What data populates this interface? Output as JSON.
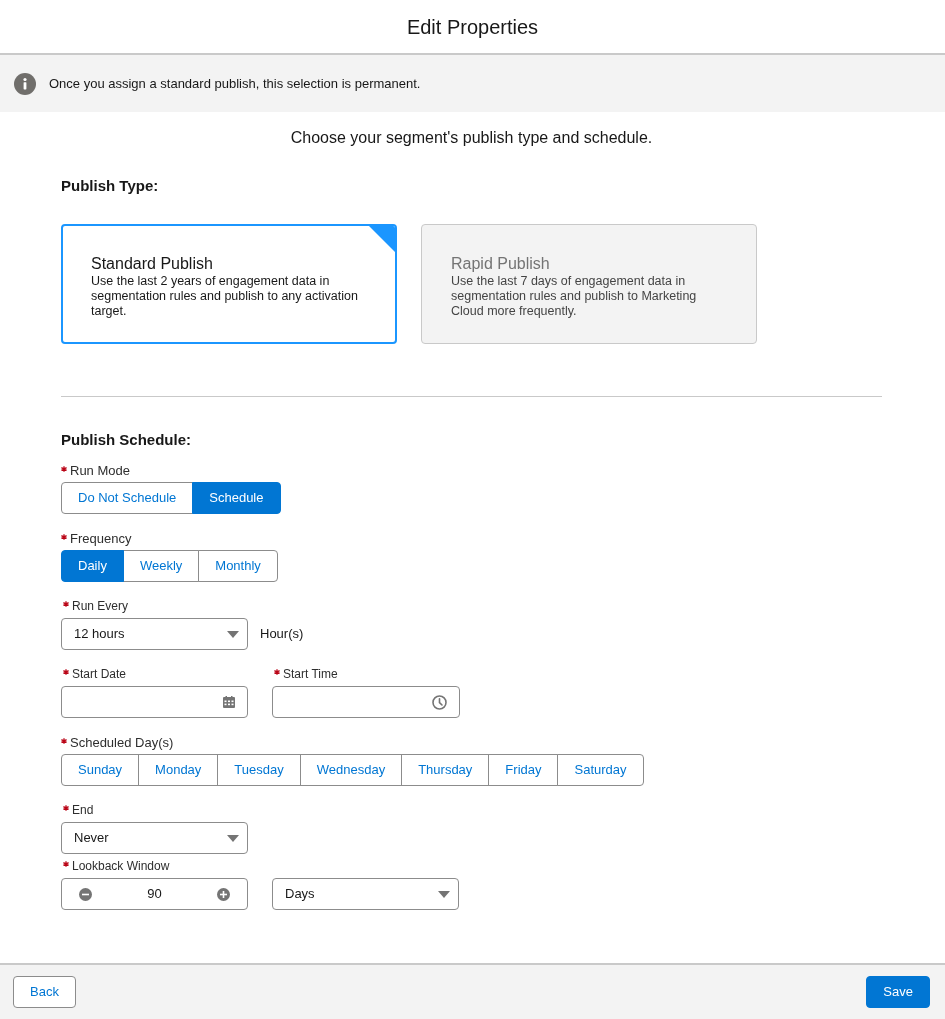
{
  "header": {
    "title": "Edit Properties"
  },
  "notice": {
    "text": "Once you assign a standard publish, this selection is permanent."
  },
  "intro": "Choose your segment's publish type and schedule.",
  "publish_type": {
    "heading": "Publish Type:",
    "options": [
      {
        "title": "Standard Publish",
        "description": "Use the last 2 years of engagement data in segmentation rules and publish to any activation target.",
        "selected": true,
        "disabled": false
      },
      {
        "title": "Rapid Publish",
        "description": "Use the last 7 days of engagement data in segmentation rules and publish to Marketing Cloud more frequently.",
        "selected": false,
        "disabled": true
      }
    ]
  },
  "publish_schedule": {
    "heading": "Publish Schedule:",
    "rows": [
      {
        "fields": [
          {
            "kind": "segmented",
            "label": "Run Mode",
            "required": true,
            "options": [
              {
                "label": "Do Not Schedule",
                "selected": false
              },
              {
                "label": "Schedule",
                "selected": true
              }
            ]
          }
        ]
      },
      {
        "fields": [
          {
            "kind": "segmented",
            "label": "Frequency",
            "required": true,
            "options": [
              {
                "label": "Daily",
                "selected": true
              },
              {
                "label": "Weekly",
                "selected": false
              },
              {
                "label": "Monthly",
                "selected": false
              }
            ]
          }
        ]
      },
      {
        "fields": [
          {
            "kind": "select",
            "label": "Run Every",
            "required": true,
            "value": "12 hours"
          },
          {
            "kind": "text",
            "text": "Hour(s)"
          }
        ]
      },
      {
        "fields": [
          {
            "kind": "date",
            "label": "Start Date",
            "required": true
          },
          {
            "kind": "time",
            "label": "Start Time",
            "required": true
          }
        ]
      },
      {
        "fields": [
          {
            "kind": "segmented",
            "label": "Scheduled Day(s)",
            "required": true,
            "options": [
              {
                "label": "Sunday",
                "selected": false
              },
              {
                "label": "Monday",
                "selected": false
              },
              {
                "label": "Tuesday",
                "selected": false
              },
              {
                "label": "Wednesday",
                "selected": false
              },
              {
                "label": "Thursday",
                "selected": false
              },
              {
                "label": "Friday",
                "selected": false
              },
              {
                "label": "Saturday",
                "selected": false
              }
            ]
          }
        ]
      },
      {
        "fields": [
          {
            "kind": "select",
            "label": "End",
            "required": true,
            "value": "Never"
          }
        ]
      },
      {
        "fields": [
          {
            "kind": "stepper",
            "label": "Lookback Window",
            "required": true,
            "value": "90"
          },
          {
            "kind": "select",
            "value": "Days"
          }
        ]
      }
    ]
  },
  "footer": {
    "buttons": [
      {
        "label": "Back",
        "kind": "neutral"
      },
      {
        "label": "Save",
        "kind": "brand"
      }
    ]
  }
}
